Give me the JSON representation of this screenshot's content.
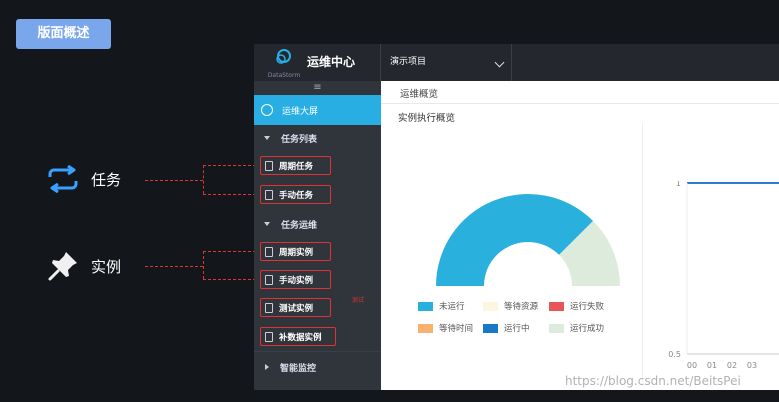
{
  "slide": {
    "badge": "版面概述",
    "legend_task": "任务",
    "legend_instance": "实例",
    "watermark": "https://blog.csdn.net/BeitsPei"
  },
  "app": {
    "logo_text": "DataStorm",
    "title": "运维中心",
    "project": "演示项目",
    "collapse_icon": "≡",
    "sidebar": {
      "dashboard": "运维大屏",
      "task_list": "任务列表",
      "periodic_task": "周期任务",
      "manual_task": "手动任务",
      "task_ops": "任务运维",
      "periodic_instance": "周期实例",
      "manual_instance": "手动实例",
      "test_instance": "测试实例",
      "test_instance_tag": "测试",
      "backfill_instance": "补数据实例",
      "monitor": "智能监控"
    },
    "breadcrumb": "运维概览",
    "card_title": "实例执行概览"
  },
  "chart_data": [
    {
      "type": "pie",
      "title": "实例执行概览",
      "legend": [
        "未运行",
        "等待资源",
        "运行失败",
        "等待时间",
        "运行中",
        "运行成功"
      ],
      "colors": [
        "#29b0dd",
        "#fdf5dd",
        "#e8545a",
        "#f8b26f",
        "#1a79c6",
        "#dcebdc"
      ],
      "values": [
        75,
        0,
        0,
        0,
        0,
        25
      ]
    },
    {
      "type": "line",
      "y_ticks": [
        "1",
        "0.5"
      ],
      "x": [
        "00",
        "01",
        "02",
        "03"
      ],
      "values": [
        1,
        1,
        1,
        1
      ]
    }
  ]
}
